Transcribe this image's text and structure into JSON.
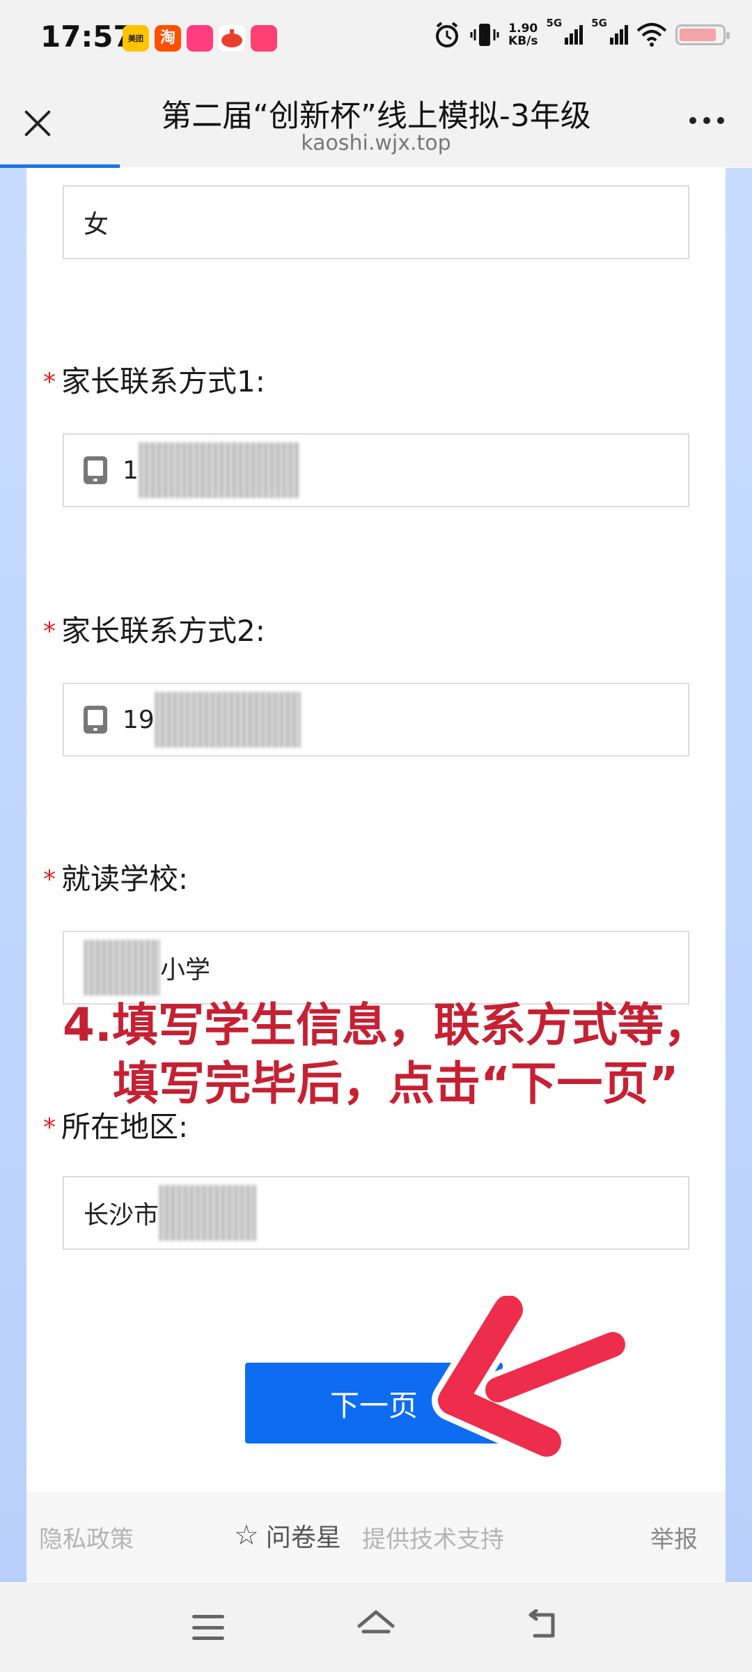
{
  "status_bar": {
    "time": "17:57",
    "app_icons": [
      {
        "name": "meituan",
        "label": "美团",
        "color": "#ffc300"
      },
      {
        "name": "taobao",
        "label": "淘",
        "color": "#ff5000"
      },
      {
        "name": "app3",
        "label": "",
        "color": "#ff3d7f"
      },
      {
        "name": "app4",
        "label": "",
        "color": "#e8402a"
      },
      {
        "name": "app5",
        "label": "",
        "color": "#ff4070"
      }
    ],
    "net_speed_value": "1.90",
    "net_speed_unit": "KB/s",
    "signal1_label": "5G",
    "signal2_label": "5G",
    "battery_color": "#f4a3a8"
  },
  "header": {
    "title": "第二届“创新杯”线上模拟-3年级",
    "url": "kaoshi.wjx.top"
  },
  "form": {
    "gender_value": "女",
    "q_parent_contact1": "家长联系方式1:",
    "parent_contact1_prefix": "1",
    "q_parent_contact2": "家长联系方式2:",
    "parent_contact2_prefix": "19",
    "q_school": "就读学校:",
    "school_suffix": "小学",
    "q_region": "所在地区:",
    "region_prefix": "长沙市",
    "required_mark": "*"
  },
  "annotation": {
    "line1": "4.填写学生信息，联系方式等，",
    "line2": "填写完毕后，点击“下一页”",
    "color": "#c62033"
  },
  "next_button": {
    "label": "下一页",
    "color": "#0d6cf2"
  },
  "footer": {
    "privacy": "隐私政策",
    "brand": "问卷星",
    "support": "提供技术支持",
    "report": "举报"
  }
}
